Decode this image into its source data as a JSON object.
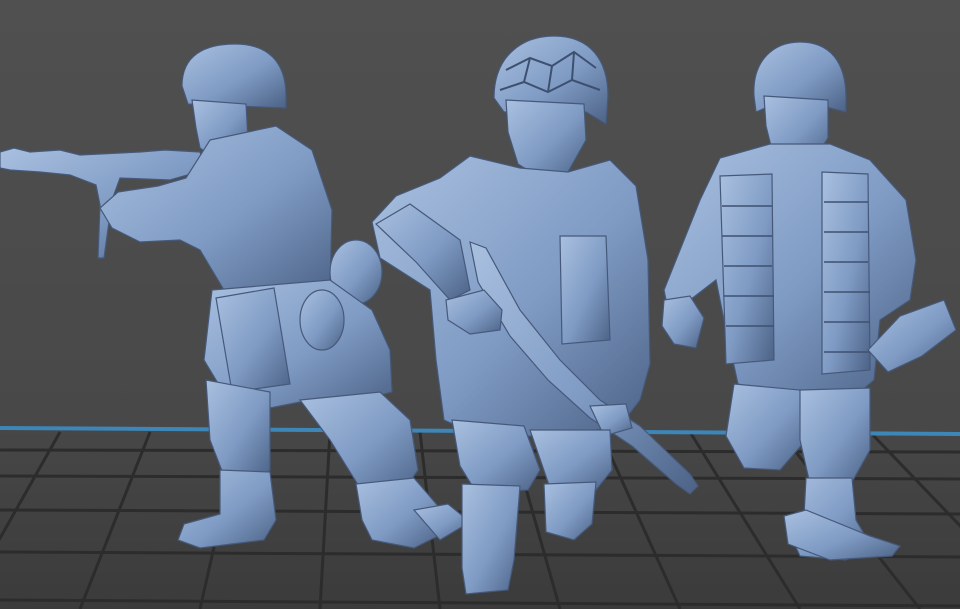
{
  "scene": {
    "description_visible_text": "",
    "colors": {
      "background": "#4a4a4a",
      "floor": "#3f3f3f",
      "grid_line": "#2c2c2c",
      "axis_line": "#3d86b8",
      "model_base": "#7f9bc4",
      "model_shadow": "#4c6286",
      "model_highlight": "#a9c0e0"
    },
    "models": [
      {
        "name": "figure-machine-gunner"
      },
      {
        "name": "figure-rifleman-netted-helmet"
      },
      {
        "name": "figure-grenadier"
      }
    ]
  }
}
